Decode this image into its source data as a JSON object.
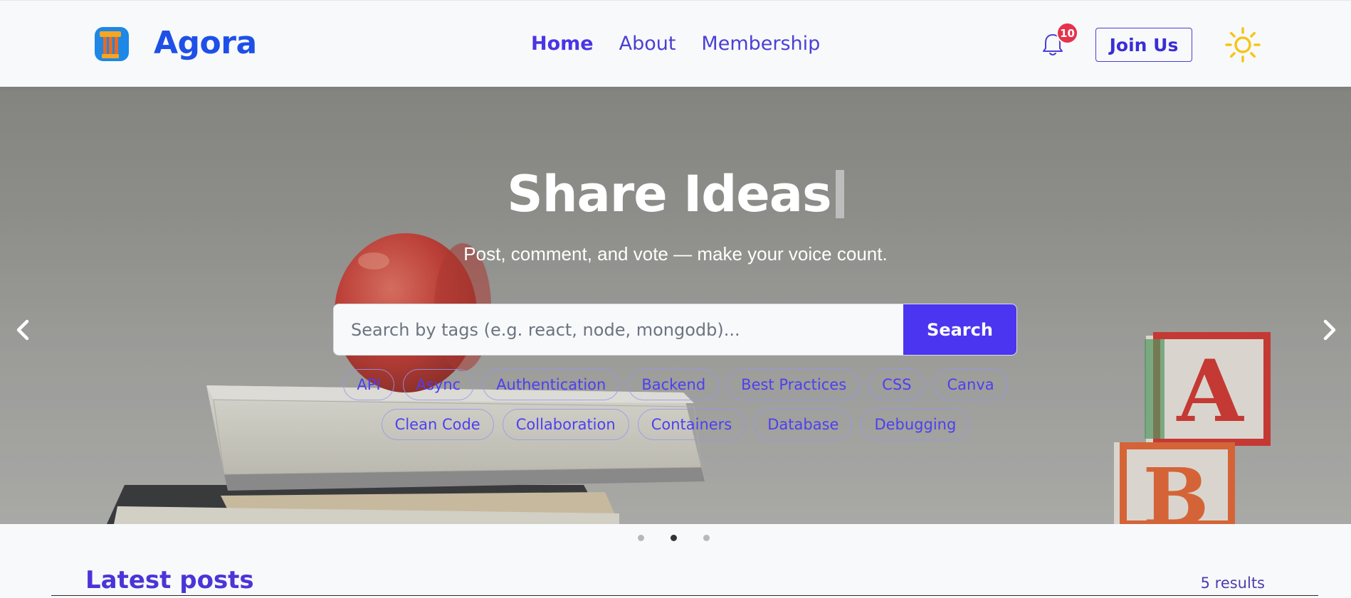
{
  "brand": {
    "name": "Agora"
  },
  "nav": {
    "items": [
      {
        "label": "Home",
        "active": true
      },
      {
        "label": "About"
      },
      {
        "label": "Membership"
      }
    ]
  },
  "header": {
    "notification_count": "10",
    "join_label": "Join Us"
  },
  "hero": {
    "title": "Share Ideas",
    "subtitle": "Post, comment, and vote — make your voice count.",
    "search_placeholder": "Search by tags (e.g. react, node, mongodb)...",
    "search_label": "Search",
    "tags": [
      "API",
      "Async",
      "Authentication",
      "Backend",
      "Best Practices",
      "CSS",
      "Canva",
      "Clean Code",
      "Collaboration",
      "Containers",
      "Database",
      "Debugging"
    ]
  },
  "carousel": {
    "slide_count": 3,
    "active_index": 1
  },
  "posts": {
    "heading": "Latest posts",
    "results_text": "5 results"
  },
  "colors": {
    "primary": "#4b35f0",
    "brand": "#1e50e8",
    "badge": "#e5334b",
    "sun": "#f5c518"
  },
  "icons": [
    "logo-icon",
    "bell-icon",
    "sun-icon",
    "chevron-left-icon",
    "chevron-right-icon"
  ]
}
